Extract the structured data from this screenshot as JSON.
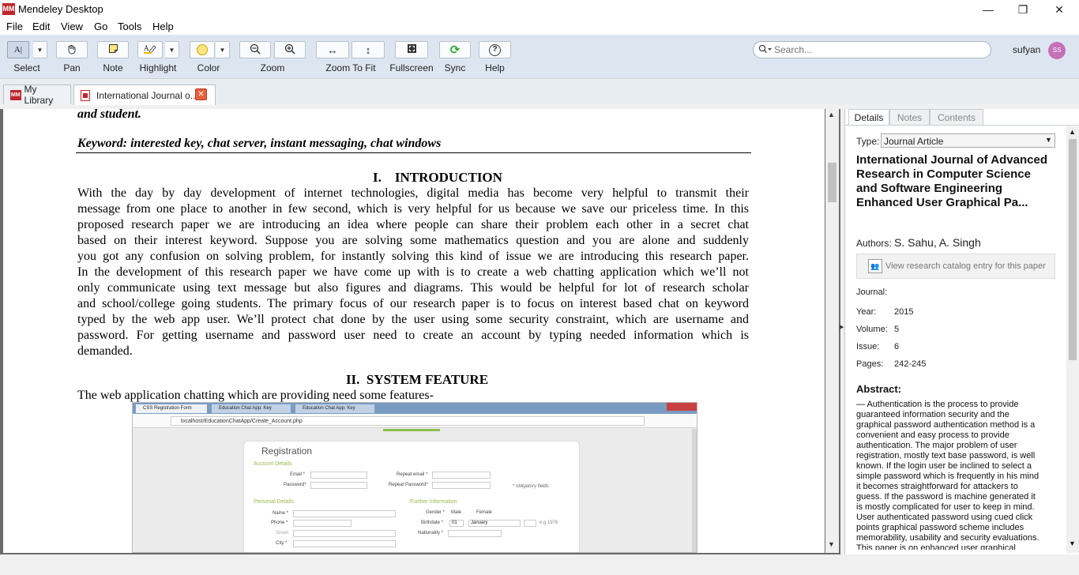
{
  "window": {
    "title": "Mendeley Desktop",
    "logo_text": "MM",
    "min": "—",
    "max": "❐",
    "close": "✕"
  },
  "menu": [
    "File",
    "Edit",
    "View",
    "Go",
    "Tools",
    "Help"
  ],
  "toolbar": {
    "select": "Select",
    "pan": "Pan",
    "note": "Note",
    "highlight": "Highlight",
    "color": "Color",
    "zoom": "Zoom",
    "zoom_to_fit": "Zoom To Fit",
    "fullscreen": "Fullscreen",
    "sync": "Sync",
    "help": "Help",
    "highlight_color": "#ffe680"
  },
  "search": {
    "placeholder": "Search..."
  },
  "user": {
    "name": "sufyan",
    "initials": "SS",
    "avatar_color": "#c670b8"
  },
  "tabs": [
    {
      "label": "My Library"
    },
    {
      "label": "International Journal o..."
    }
  ],
  "document": {
    "line_top": "and student.",
    "keyword": "Keyword: interested key, chat server, instant messaging, chat windows",
    "h1": "I.    INTRODUCTION",
    "intro": [
      "With the day by day development of internet technologies, digital media has become very helpful to transmit their",
      "message from one place to another in few second, which is very helpful for us because we save our priceless time. In this",
      "proposed research paper we are introducing an idea where people can share their problem each other in a secret chat",
      "based on their interest keyword. Suppose you are solving some mathematics question and you are alone and suddenly",
      "you got any confusion on solving problem, for instantly solving this kind of issue we are introducing this research paper.",
      "In the development of this research paper we have come up with is to create a web chatting application which we’ll not",
      "only communicate using text message but also figures and diagrams. This would be helpful for lot of research scholar",
      "and school/college going students. The primary focus of our research paper is to focus on interest based chat on keyword",
      "typed by the web app user. We’ll protect chat done by the user using some security constraint, which are username and",
      "password. For getting username and password user need to create an account by typing needed information which is"
    ],
    "intro_last": "demanded.",
    "h2": "II.  SYSTEM FEATURE",
    "features_line": "The web application chatting which are providing need some features-",
    "figure": {
      "tabs": [
        "CSS Registration Form",
        "Education Chat App: Key",
        "Education Chat App: Key"
      ],
      "url": "localhost/EducationChatApp/Create_Account.php",
      "form_title": "Registration",
      "account_details": "Account Details",
      "email": "Email *",
      "repeat_email": "Repeat email *",
      "password": "Password*",
      "repeat_password": "Repeat Password*",
      "obligatory": "* obligatory fields",
      "personal_details": "Personal Details",
      "further_information": "Further Information",
      "name": "Name *",
      "phone": "Phone *",
      "street": "Street",
      "city": "City *",
      "gender": "Gender *",
      "male": "Male",
      "female": "Female",
      "birthdate": "Birthdate *",
      "day": "01",
      "month": "January",
      "eg": "e.g 1976",
      "nationality": "Nationality *"
    }
  },
  "details": {
    "tabs": [
      "Details",
      "Notes",
      "Contents"
    ],
    "type_label": "Type:",
    "type_value": "Journal Article",
    "title": "International Journal of Advanced Research in Computer Science and Software Engineering Enhanced User Graphical Pa...",
    "authors_label": "Authors:",
    "authors": "S. Sahu, A. Singh",
    "catalog_link": "View research catalog entry for this paper",
    "journal_label": "Journal:",
    "year_label": "Year:",
    "year": "2015",
    "volume_label": "Volume:",
    "volume": "5",
    "issue_label": "Issue:",
    "issue": "6",
    "pages_label": "Pages:",
    "pages": "242-245",
    "abstract_label": "Abstract:",
    "abstract": "— Authentication is the process to provide guaranteed information security and the graphical password authentication method is a convenient and easy process to provide authentication. The major problem of user registration, mostly text base password, is well known. If the login user be inclined to select a simple password which is frequently in his mind it becomes straightforward for attackers to guess. If the password is machine generated it is mostly complicated for user to keep in mind. User authenticated password using cued click points graphical password scheme includes memorability, usability and security evaluations. This paper is on enhanced user graphical"
  }
}
